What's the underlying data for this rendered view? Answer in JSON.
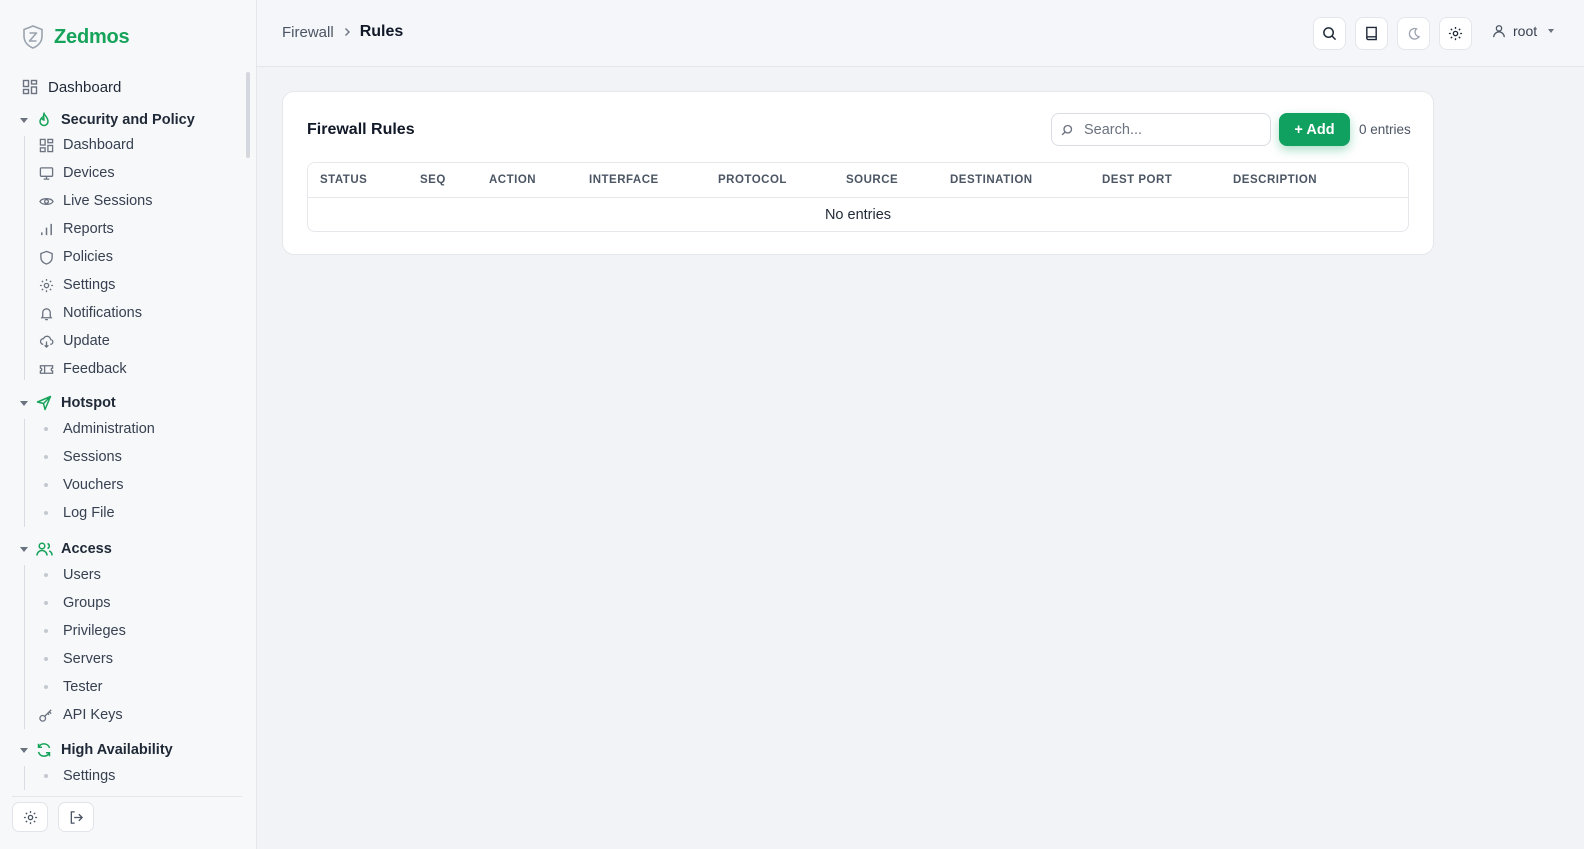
{
  "brand": {
    "name": "Zedmos"
  },
  "colors": {
    "accent": "#10a060",
    "brand": "#16a35a"
  },
  "sidebar": {
    "top_item": {
      "label": "Dashboard",
      "icon": "grid-icon"
    },
    "sections": [
      {
        "label": "Security and Policy",
        "icon": "flame-icon",
        "items": [
          {
            "label": "Dashboard",
            "icon": "grid-icon"
          },
          {
            "label": "Devices",
            "icon": "monitor-icon"
          },
          {
            "label": "Live Sessions",
            "icon": "eye-icon"
          },
          {
            "label": "Reports",
            "icon": "bar-chart-icon"
          },
          {
            "label": "Policies",
            "icon": "shield-icon"
          },
          {
            "label": "Settings",
            "icon": "gear-icon"
          },
          {
            "label": "Notifications",
            "icon": "bell-icon"
          },
          {
            "label": "Update",
            "icon": "cloud-download-icon"
          },
          {
            "label": "Feedback",
            "icon": "ticket-icon"
          }
        ]
      },
      {
        "label": "Hotspot",
        "icon": "send-icon",
        "items": [
          {
            "label": "Administration"
          },
          {
            "label": "Sessions"
          },
          {
            "label": "Vouchers"
          },
          {
            "label": "Log File"
          }
        ]
      },
      {
        "label": "Access",
        "icon": "users-icon",
        "items": [
          {
            "label": "Users"
          },
          {
            "label": "Groups"
          },
          {
            "label": "Privileges"
          },
          {
            "label": "Servers"
          },
          {
            "label": "Tester"
          },
          {
            "label": "API Keys",
            "icon": "key-icon"
          }
        ]
      },
      {
        "label": "High Availability",
        "icon": "refresh-icon",
        "items": [
          {
            "label": "Settings"
          }
        ]
      }
    ]
  },
  "header": {
    "breadcrumb": [
      "Firewall",
      "Rules"
    ],
    "user": "root"
  },
  "card": {
    "title": "Firewall Rules",
    "search_placeholder": "Search...",
    "add_label": "+ Add",
    "entries": "0 entries",
    "columns": [
      "STATUS",
      "SEQ",
      "ACTION",
      "INTERFACE",
      "PROTOCOL",
      "SOURCE",
      "DESTINATION",
      "DEST PORT",
      "DESCRIPTION"
    ],
    "empty_text": "No entries"
  }
}
